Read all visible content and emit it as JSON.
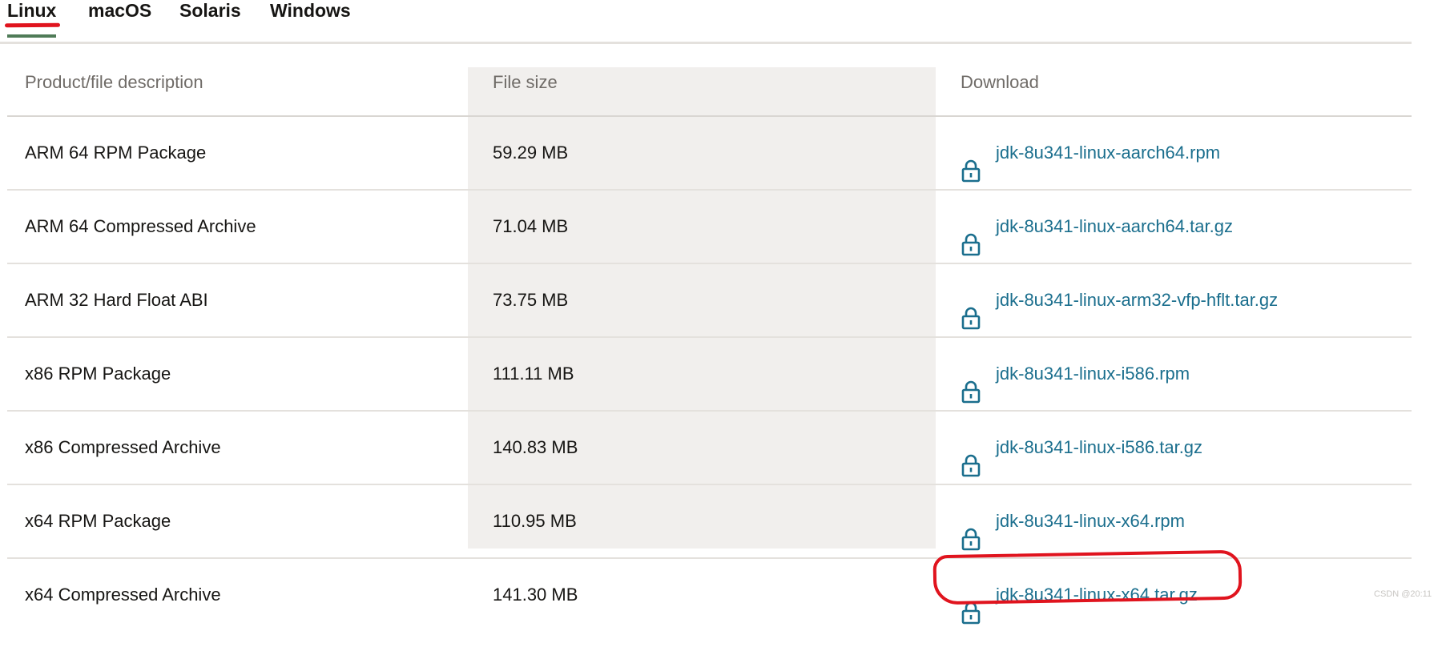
{
  "tabs": [
    {
      "label": "Linux",
      "active": true
    },
    {
      "label": "macOS",
      "active": false
    },
    {
      "label": "Solaris",
      "active": false
    },
    {
      "label": "Windows",
      "active": false
    }
  ],
  "table": {
    "headers": {
      "description": "Product/file description",
      "size": "File size",
      "download": "Download"
    },
    "rows": [
      {
        "description": "ARM 64 RPM Package",
        "size": "59.29 MB",
        "file": "jdk-8u341-linux-aarch64.rpm"
      },
      {
        "description": "ARM 64 Compressed Archive",
        "size": "71.04 MB",
        "file": "jdk-8u341-linux-aarch64.tar.gz"
      },
      {
        "description": "ARM 32 Hard Float ABI",
        "size": "73.75 MB",
        "file": "jdk-8u341-linux-arm32-vfp-hflt.tar.gz"
      },
      {
        "description": "x86 RPM Package",
        "size": "111.11 MB",
        "file": "jdk-8u341-linux-i586.rpm"
      },
      {
        "description": "x86 Compressed Archive",
        "size": "140.83 MB",
        "file": "jdk-8u341-linux-i586.tar.gz"
      },
      {
        "description": "x64 RPM Package",
        "size": "110.95 MB",
        "file": "jdk-8u341-linux-x64.rpm"
      },
      {
        "description": "x64 Compressed Archive",
        "size": "141.30 MB",
        "file": "jdk-8u341-linux-x64.tar.gz"
      }
    ]
  },
  "icons": {
    "download": "lock-icon"
  },
  "colors": {
    "link": "#1a6e8d",
    "tab_underline": "#4f7b57",
    "annotation": "#e0141e",
    "size_column_bg": "#f1efed"
  },
  "watermark": "CSDN @20:11"
}
